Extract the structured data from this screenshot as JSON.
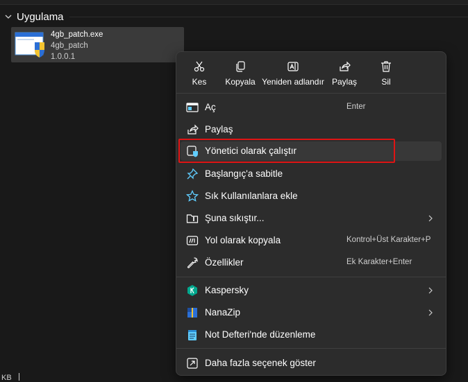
{
  "group": {
    "title": "Uygulama"
  },
  "file": {
    "name": "4gb_patch.exe",
    "description": "4gb_patch",
    "version": "1.0.0.1"
  },
  "status_bar": {
    "text": "KB"
  },
  "context_menu": {
    "quick_actions": [
      {
        "label": "Kes",
        "icon": "scissors-icon"
      },
      {
        "label": "Kopyala",
        "icon": "copy-icon"
      },
      {
        "label": "Yeniden adlandır",
        "icon": "rename-icon"
      },
      {
        "label": "Paylaş",
        "icon": "share-icon"
      },
      {
        "label": "Sil",
        "icon": "trash-icon"
      }
    ],
    "items": [
      {
        "label": "Aç",
        "shortcut": "Enter",
        "icon": "open-app-icon"
      },
      {
        "label": "Paylaş",
        "shortcut": "",
        "icon": "share-icon"
      },
      {
        "label": "Yönetici olarak çalıştır",
        "shortcut": "",
        "icon": "run-as-admin-icon",
        "hovered": true
      },
      {
        "label": "Başlangıç'a sabitle",
        "shortcut": "",
        "icon": "pin-icon"
      },
      {
        "label": "Sık Kullanılanlara ekle",
        "shortcut": "",
        "icon": "star-icon"
      },
      {
        "label": "Şuna sıkıştır...",
        "shortcut": "",
        "icon": "zip-folder-icon",
        "submenu": true
      },
      {
        "label": "Yol olarak kopyala",
        "shortcut": "Kontrol+Üst Karakter+P",
        "icon": "copy-path-icon"
      },
      {
        "label": "Özellikler",
        "shortcut": "Ek Karakter+Enter",
        "icon": "wrench-icon"
      },
      {
        "label": "Kaspersky",
        "shortcut": "",
        "icon": "kaspersky-icon",
        "submenu": true
      },
      {
        "label": "NanaZip",
        "shortcut": "",
        "icon": "nanazip-icon",
        "submenu": true
      },
      {
        "label": "Not Defteri'nde düzenleme",
        "shortcut": "",
        "icon": "notepad-icon"
      },
      {
        "label": "Daha fazla seçenek göster",
        "shortcut": "",
        "icon": "more-options-icon"
      }
    ]
  },
  "colors": {
    "accent": "#60cdff",
    "highlight_box": "#e01414",
    "menu_bg": "#2c2c2c",
    "background": "#191919"
  }
}
